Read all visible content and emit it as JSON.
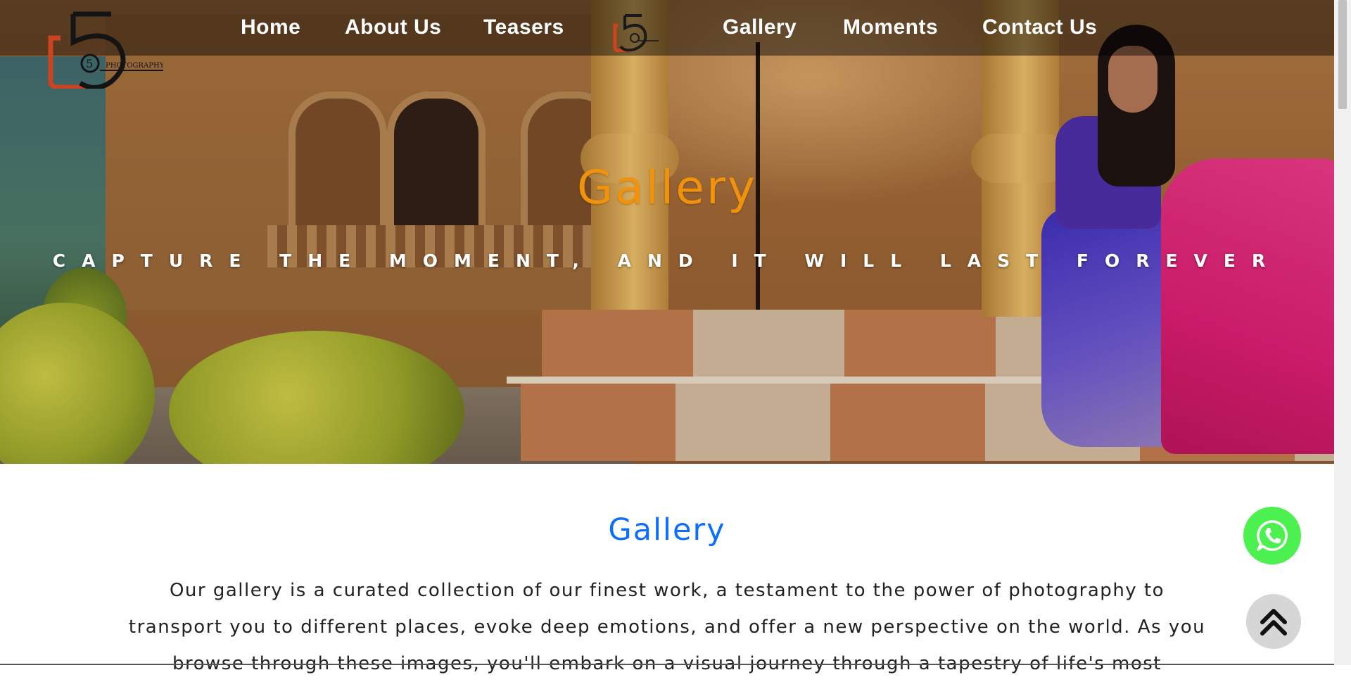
{
  "nav": {
    "items": [
      {
        "label": "Home"
      },
      {
        "label": "About Us"
      },
      {
        "label": "Teasers"
      },
      {
        "label": "Gallery"
      },
      {
        "label": "Moments"
      },
      {
        "label": "Contact Us"
      }
    ],
    "logo_text": "PHOTOGRAPHY",
    "logo_number": "5"
  },
  "hero": {
    "title": "Gallery",
    "tagline": "CAPTURE THE MOMENT, AND IT WILL LAST FOREVER"
  },
  "content": {
    "title": "Gallery",
    "body": "Our gallery is a curated collection of our finest work, a testament to the power of photography to transport you to different places, evoke deep emotions, and offer a new perspective on the world. As you browse through these images, you'll embark on a visual journey through a tapestry of life's most"
  },
  "floating": {
    "whatsapp_icon": "whatsapp-icon",
    "back_to_top_icon": "double-chevron-up-icon"
  },
  "colors": {
    "hero_title": "#f0920b",
    "section_title": "#0d6efd",
    "whatsapp": "#4cf04f",
    "logo_orange": "#c9441f"
  }
}
